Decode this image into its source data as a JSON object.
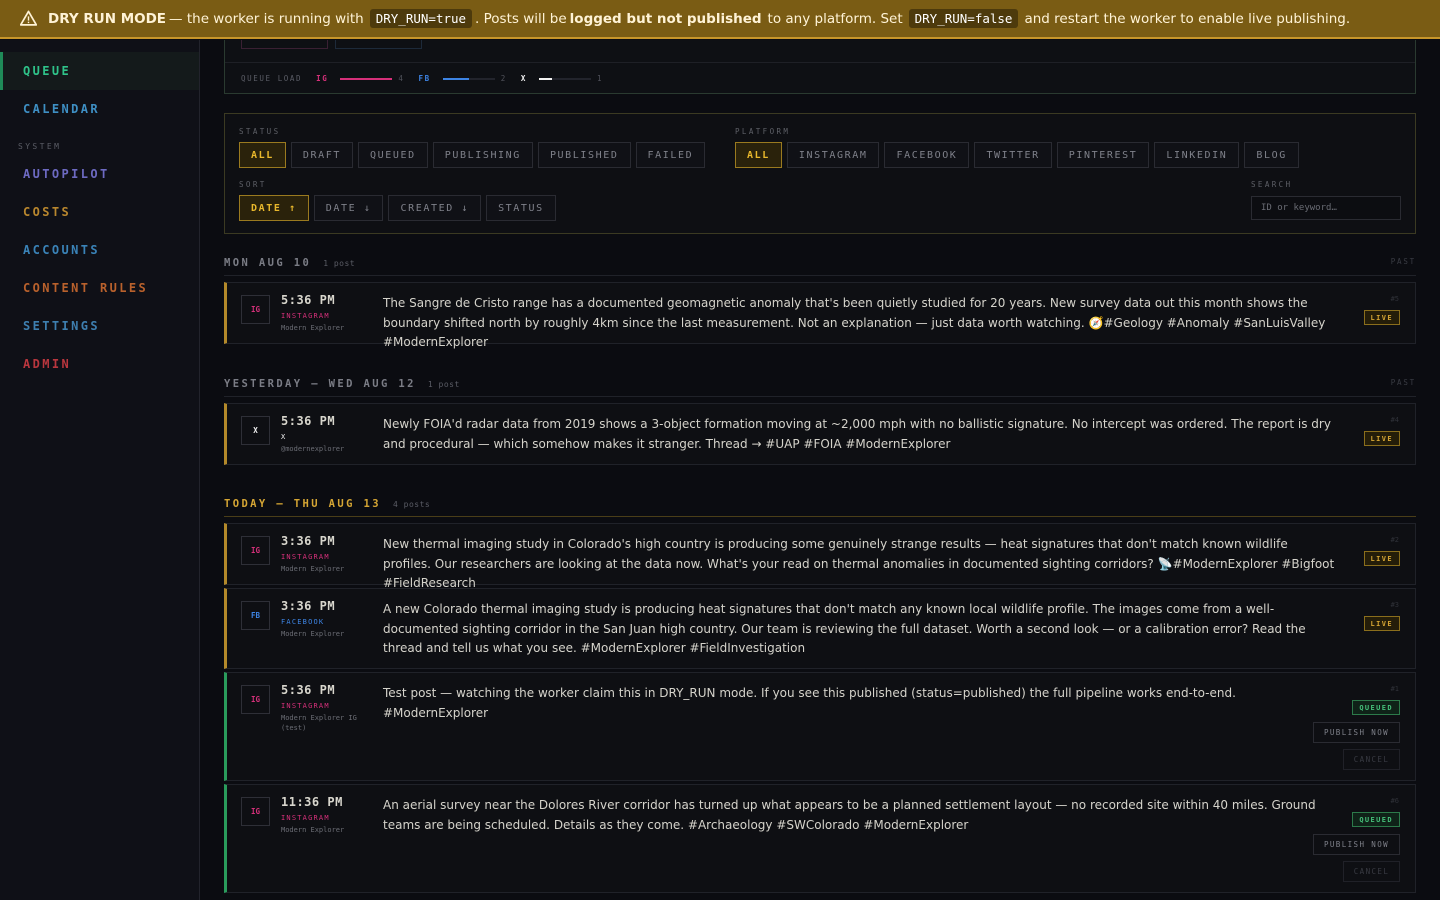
{
  "banner": {
    "title": "DRY RUN MODE",
    "t1": "— the worker is running with",
    "code1": "DRY_RUN=true",
    "t2": ". Posts will be",
    "bold2": "logged but not published",
    "t3": "to any platform. Set",
    "code2": "DRY_RUN=false",
    "t4": "and restart the worker to enable live publishing."
  },
  "sidebar": {
    "items": [
      {
        "label": "QUEUE",
        "color": "#2fc38a"
      },
      {
        "label": "CALENDAR",
        "color": "#3e8fc4"
      },
      {
        "label": "AUTOPILOT",
        "color": "#6d6ac2"
      },
      {
        "label": "COSTS",
        "color": "#b9872e"
      },
      {
        "label": "ACCOUNTS",
        "color": "#3a83b8"
      },
      {
        "label": "CONTENT RULES",
        "color": "#b9612c"
      },
      {
        "label": "SETTINGS",
        "color": "#3e7fb0"
      },
      {
        "label": "ADMIN",
        "color": "#b9363e"
      }
    ],
    "section": "SYSTEM"
  },
  "queue_load": {
    "label": "QUEUE LOAD",
    "items": [
      {
        "platform": "IG",
        "count": "4",
        "color": "#d6307a"
      },
      {
        "platform": "FB",
        "count": "2",
        "color": "#3d84e4"
      },
      {
        "platform": "X",
        "count": "1",
        "color": "#f2f2f2"
      }
    ]
  },
  "filters": {
    "status_label": "STATUS",
    "status": [
      "ALL",
      "DRAFT",
      "QUEUED",
      "PUBLISHING",
      "PUBLISHED",
      "FAILED"
    ],
    "platform_label": "PLATFORM",
    "platform": [
      "ALL",
      "INSTAGRAM",
      "FACEBOOK",
      "TWITTER",
      "PINTEREST",
      "LINKEDIN",
      "BLOG"
    ],
    "sort_label": "SORT",
    "sort": [
      "DATE ↑",
      "DATE ↓",
      "CREATED ↓",
      "STATUS"
    ],
    "search_label": "SEARCH",
    "search_placeholder": "ID or keyword…"
  },
  "days": [
    {
      "label": "MON AUG 10",
      "count": "1 post",
      "tag": "PAST"
    },
    {
      "label": "YESTERDAY — WED AUG 12",
      "count": "1 post",
      "tag": "PAST"
    },
    {
      "label": "TODAY — THU AUG 13",
      "count": "4 posts"
    }
  ],
  "posts": [
    {
      "pcode": "IG",
      "time": "5:36 PM",
      "platform": "INSTAGRAM",
      "account": "Modern Explorer",
      "id": "#5",
      "status": "LIVE",
      "body": "The Sangre de Cristo range has a documented geomagnetic anomaly that's been quietly studied for 20 years. New survey data out this month shows the boundary shifted north by roughly 4km since the last measurement. Not an explanation — just data worth watching. 🧭#Geology #Anomaly #SanLuisValley #ModernExplorer"
    },
    {
      "pcode": "X",
      "time": "5:36 PM",
      "platform": "X",
      "account": "@modernexplorer",
      "id": "#4",
      "status": "LIVE",
      "body": "Newly FOIA'd radar data from 2019 shows a 3-object formation moving at ~2,000 mph with no ballistic signature. No intercept was ordered. The report is dry and procedural — which somehow makes it stranger. Thread → #UAP #FOIA #ModernExplorer"
    },
    {
      "pcode": "IG",
      "time": "3:36 PM",
      "platform": "INSTAGRAM",
      "account": "Modern Explorer",
      "id": "#2",
      "status": "LIVE",
      "body": "New thermal imaging study in Colorado's high country is producing some genuinely strange results — heat signatures that don't match known wildlife profiles. Our researchers are looking at the data now. What's your read on thermal anomalies in documented sighting corridors? 📡#ModernExplorer #Bigfoot #FieldResearch"
    },
    {
      "pcode": "FB",
      "time": "3:36 PM",
      "platform": "FACEBOOK",
      "account": "Modern Explorer",
      "id": "#3",
      "status": "LIVE",
      "body": "A new Colorado thermal imaging study is producing heat signatures that don't match any known local wildlife profile. The images come from a well-documented sighting corridor in the San Juan high country. Our team is reviewing the full dataset. Worth a second look — or a calibration error? Read the thread and tell us what you see. #ModernExplorer #FieldInvestigation"
    },
    {
      "pcode": "IG",
      "time": "5:36 PM",
      "platform": "INSTAGRAM",
      "account": "Modern Explorer IG (test)",
      "id": "#1",
      "status": "QUEUED",
      "publish": "PUBLISH NOW",
      "cancel": "CANCEL",
      "body": "Test post — watching the worker claim this in DRY_RUN mode. If you see this published (status=published) the full pipeline works end-to-end. #ModernExplorer"
    },
    {
      "pcode": "IG",
      "time": "11:36 PM",
      "platform": "INSTAGRAM",
      "account": "Modern Explorer",
      "id": "#6",
      "status": "QUEUED",
      "publish": "PUBLISH NOW",
      "cancel": "CANCEL",
      "body": "An aerial survey near the Dolores River corridor has turned up what appears to be a planned settlement layout — no recorded site within 40 miles. Ground teams are being scheduled. Details as they come. #Archaeology #SWColorado #ModernExplorer"
    }
  ],
  "colors": {
    "instagram": "#d6307a",
    "facebook": "#3d84e4",
    "x": "#f2f2f2",
    "live": "#d6a634",
    "queued": "#46c07a"
  }
}
